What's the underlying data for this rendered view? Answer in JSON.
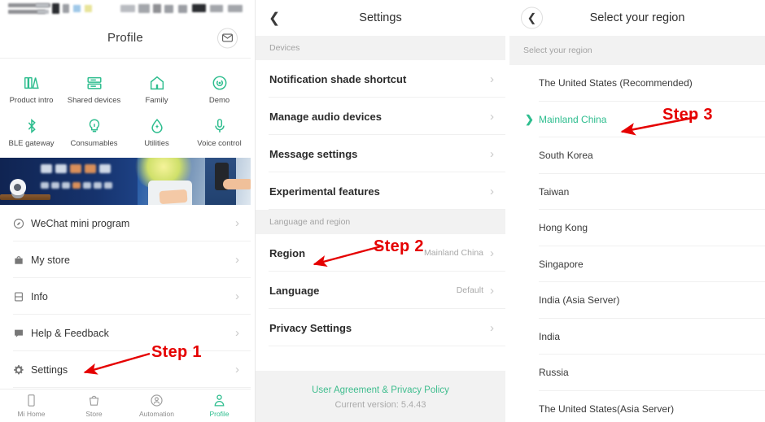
{
  "accent": "#2dbd8e",
  "annotation_color": "#e50000",
  "panel1": {
    "header": {
      "title": "Profile",
      "mail_icon": "mail-icon"
    },
    "shortcuts": [
      {
        "label": "Product intro",
        "icon": "books-icon"
      },
      {
        "label": "Shared devices",
        "icon": "server-stack-icon"
      },
      {
        "label": "Family",
        "icon": "home-icon"
      },
      {
        "label": "Demo",
        "icon": "target-circle-icon"
      },
      {
        "label": "BLE gateway",
        "icon": "bluetooth-icon"
      },
      {
        "label": "Consumables",
        "icon": "lightbulb-icon"
      },
      {
        "label": "Utilities",
        "icon": "water-drop-icon"
      },
      {
        "label": "Voice control",
        "icon": "microphone-icon"
      }
    ],
    "menu": [
      {
        "label": "WeChat mini program",
        "icon": "wechat-icon"
      },
      {
        "label": "My store",
        "icon": "store-bag-icon"
      },
      {
        "label": "Info",
        "icon": "info-book-icon"
      },
      {
        "label": "Help & Feedback",
        "icon": "chat-icon"
      },
      {
        "label": "Settings",
        "icon": "gear-icon"
      }
    ],
    "tabs": [
      {
        "label": "Mi Home",
        "icon": "device-icon",
        "active": false
      },
      {
        "label": "Store",
        "icon": "basket-icon",
        "active": false
      },
      {
        "label": "Automation",
        "icon": "automation-icon",
        "active": false
      },
      {
        "label": "Profile",
        "icon": "person-icon",
        "active": true
      }
    ],
    "annotation": {
      "step": "Step 1"
    }
  },
  "panel2": {
    "nav": {
      "title": "Settings",
      "back_icon": "chevron-left-icon"
    },
    "sections": [
      {
        "title": "Devices",
        "rows": [
          {
            "label": "Notification shade shortcut",
            "value": ""
          },
          {
            "label": "Manage audio devices",
            "value": ""
          },
          {
            "label": "Message settings",
            "value": ""
          },
          {
            "label": "Experimental features",
            "value": ""
          }
        ]
      },
      {
        "title": "Language and region",
        "rows": [
          {
            "label": "Region",
            "value": "Mainland China"
          },
          {
            "label": "Language",
            "value": "Default"
          },
          {
            "label": "Privacy Settings",
            "value": ""
          }
        ]
      }
    ],
    "footer": {
      "link": "User Agreement & Privacy Policy",
      "version": "Current version: 5.4.43"
    },
    "annotation": {
      "step": "Step 2"
    }
  },
  "panel3": {
    "nav": {
      "title": "Select your region",
      "back_icon": "chevron-left-icon"
    },
    "section_title": "Select your region",
    "regions": [
      {
        "label": "The United States (Recommended)",
        "selected": false
      },
      {
        "label": "Mainland China",
        "selected": true
      },
      {
        "label": "South Korea",
        "selected": false
      },
      {
        "label": "Taiwan",
        "selected": false
      },
      {
        "label": "Hong Kong",
        "selected": false
      },
      {
        "label": "Singapore",
        "selected": false
      },
      {
        "label": "India (Asia Server)",
        "selected": false
      },
      {
        "label": "India",
        "selected": false
      },
      {
        "label": "Russia",
        "selected": false
      },
      {
        "label": "The United States(Asia Server)",
        "selected": false
      }
    ],
    "annotation": {
      "step": "Step 3"
    }
  }
}
